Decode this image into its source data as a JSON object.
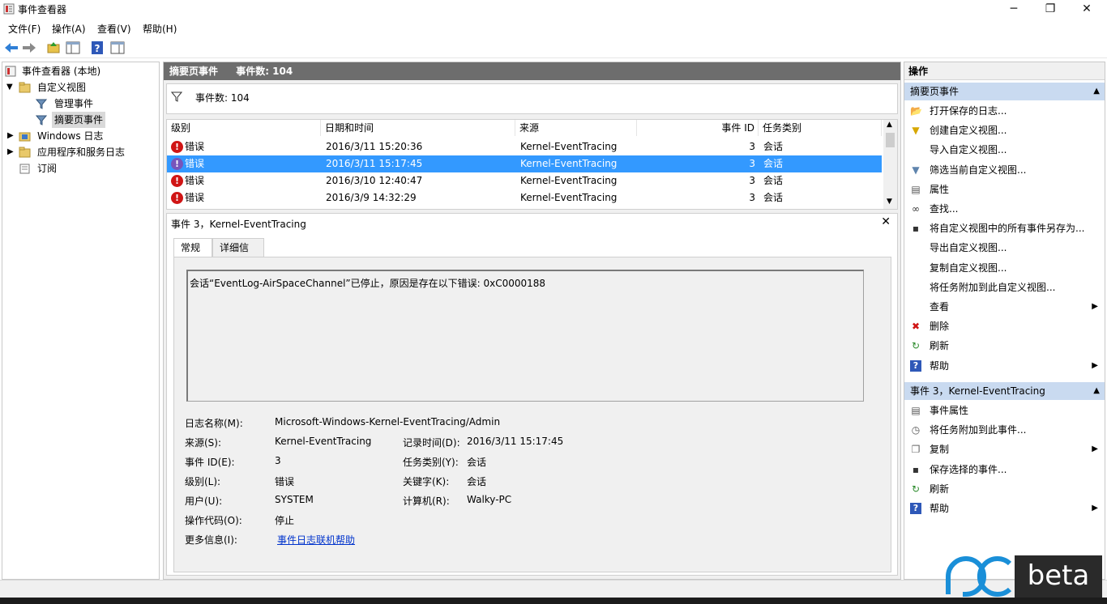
{
  "window": {
    "title": "事件查看器",
    "minimize": "─",
    "maximize": "❐",
    "close": "✕"
  },
  "menu": [
    "文件(F)",
    "操作(A)",
    "查看(V)",
    "帮助(H)"
  ],
  "tree": {
    "root": "事件查看器 (本地)",
    "custom_views": "自定义视图",
    "admin_events": "管理事件",
    "summary_events": "摘要页事件",
    "windows_logs": "Windows 日志",
    "app_service_logs": "应用程序和服务日志",
    "subscriptions": "订阅"
  },
  "center": {
    "header_title": "摘要页事件",
    "header_count": "事件数: 104",
    "filter_count": "事件数: 104",
    "columns": [
      "级别",
      "日期和时间",
      "来源",
      "事件 ID",
      "任务类别"
    ],
    "rows": [
      {
        "level": "错误",
        "datetime": "2016/3/11 15:20:36",
        "source": "Kernel-EventTracing",
        "event_id": "3",
        "category": "会话",
        "selected": false
      },
      {
        "level": "错误",
        "datetime": "2016/3/11 15:17:45",
        "source": "Kernel-EventTracing",
        "event_id": "3",
        "category": "会话",
        "selected": true
      },
      {
        "level": "错误",
        "datetime": "2016/3/10 12:40:47",
        "source": "Kernel-EventTracing",
        "event_id": "3",
        "category": "会话",
        "selected": false
      },
      {
        "level": "错误",
        "datetime": "2016/3/9 14:32:29",
        "source": "Kernel-EventTracing",
        "event_id": "3",
        "category": "会话",
        "selected": false
      }
    ]
  },
  "detail": {
    "title": "事件 3，Kernel-EventTracing",
    "close": "✕",
    "tab_general": "常规",
    "tab_details": "详细信息",
    "message": "会话“EventLog-AirSpaceChannel”已停止，原因是存在以下错误: 0xC0000188",
    "log_name_label": "日志名称(M):",
    "log_name": "Microsoft-Windows-Kernel-EventTracing/Admin",
    "source_label": "来源(S):",
    "source": "Kernel-EventTracing",
    "logged_label": "记录时间(D):",
    "logged": "2016/3/11 15:17:45",
    "event_id_label": "事件 ID(E):",
    "event_id": "3",
    "task_label": "任务类别(Y):",
    "task": "会话",
    "level_label": "级别(L):",
    "level": "错误",
    "keywords_label": "关键字(K):",
    "keywords": "会话",
    "user_label": "用户(U):",
    "user": "SYSTEM",
    "computer_label": "计算机(R):",
    "computer": "Walky-PC",
    "opcode_label": "操作代码(O):",
    "opcode": "停止",
    "more_info_label": "更多信息(I):",
    "more_info_link": "事件日志联机帮助"
  },
  "actions": {
    "title": "操作",
    "section1": "摘要页事件",
    "items1": [
      {
        "label": "打开保存的日志...",
        "icon": "folder-open-icon",
        "submenu": false
      },
      {
        "label": "创建自定义视图...",
        "icon": "filter-create-icon",
        "submenu": false
      },
      {
        "label": "导入自定义视图...",
        "icon": "",
        "submenu": false
      },
      {
        "label": "筛选当前自定义视图...",
        "icon": "filter-icon",
        "submenu": false
      },
      {
        "label": "属性",
        "icon": "properties-icon",
        "submenu": false
      },
      {
        "label": "查找...",
        "icon": "binoculars-icon",
        "submenu": false
      },
      {
        "label": "将自定义视图中的所有事件另存为...",
        "icon": "save-icon",
        "submenu": false
      },
      {
        "label": "导出自定义视图...",
        "icon": "",
        "submenu": false
      },
      {
        "label": "复制自定义视图...",
        "icon": "",
        "submenu": false
      },
      {
        "label": "将任务附加到此自定义视图...",
        "icon": "",
        "submenu": false
      },
      {
        "label": "查看",
        "icon": "",
        "submenu": true
      },
      {
        "label": "删除",
        "icon": "delete-icon",
        "submenu": false
      },
      {
        "label": "刷新",
        "icon": "refresh-icon",
        "submenu": false
      },
      {
        "label": "帮助",
        "icon": "help-icon",
        "submenu": true
      }
    ],
    "section2": "事件 3，Kernel-EventTracing",
    "items2": [
      {
        "label": "事件属性",
        "icon": "properties-icon",
        "submenu": false
      },
      {
        "label": "将任务附加到此事件...",
        "icon": "task-icon",
        "submenu": false
      },
      {
        "label": "复制",
        "icon": "copy-icon",
        "submenu": true
      },
      {
        "label": "保存选择的事件...",
        "icon": "save-icon",
        "submenu": false
      },
      {
        "label": "刷新",
        "icon": "refresh-icon",
        "submenu": false
      },
      {
        "label": "帮助",
        "icon": "help-icon",
        "submenu": true
      }
    ]
  },
  "watermark": {
    "text": "beta"
  },
  "colors": {
    "selection": "#3399ff",
    "error": "#d01515",
    "section_header": "#c9daf0",
    "pane_header": "#6d6d6d"
  }
}
